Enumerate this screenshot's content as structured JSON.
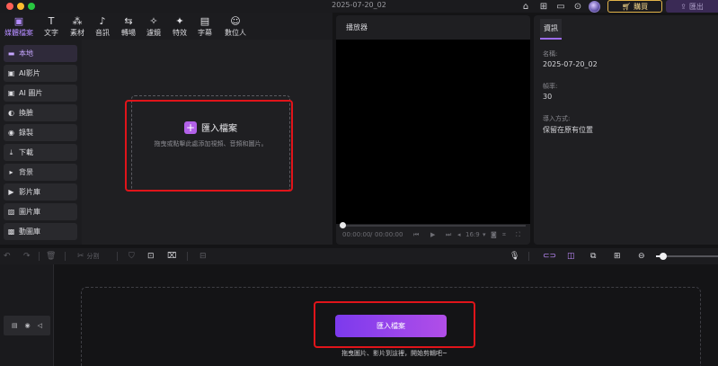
{
  "window": {
    "title": "2025-07-20_02",
    "buy_label": "購買",
    "export_label": "匯出"
  },
  "media_tabs": [
    {
      "label": "媒體檔案",
      "icon": "media-icon",
      "glyph": "▣"
    },
    {
      "label": "文字",
      "icon": "text-icon",
      "glyph": "T"
    },
    {
      "label": "素材",
      "icon": "elements-icon",
      "glyph": "⁂"
    },
    {
      "label": "音訊",
      "icon": "music-icon",
      "glyph": "♪"
    },
    {
      "label": "轉場",
      "icon": "transition-icon",
      "glyph": "⇆"
    },
    {
      "label": "濾鏡",
      "icon": "filter-icon",
      "glyph": "✧"
    },
    {
      "label": "特效",
      "icon": "effects-icon",
      "glyph": "✦"
    },
    {
      "label": "字幕",
      "icon": "subtitle-icon",
      "glyph": "▤"
    },
    {
      "label": "數位人",
      "icon": "avatar-icon",
      "glyph": "☺"
    }
  ],
  "sidebar": {
    "items": [
      {
        "label": "本地",
        "icon": "folder-icon",
        "glyph": "▬"
      },
      {
        "label": "AI影片",
        "icon": "ai-video-icon",
        "glyph": "▣"
      },
      {
        "label": "AI 圖片",
        "icon": "ai-image-icon",
        "glyph": "▣"
      },
      {
        "label": "換臉",
        "icon": "face-swap-icon",
        "glyph": "◐"
      },
      {
        "label": "錄製",
        "icon": "record-icon",
        "glyph": "◉"
      },
      {
        "label": "下載",
        "icon": "download-icon",
        "glyph": "⤓"
      },
      {
        "label": "背景",
        "icon": "background-icon",
        "glyph": "▸"
      },
      {
        "label": "影片庫",
        "icon": "video-library-icon",
        "glyph": "▶"
      },
      {
        "label": "圖片庫",
        "icon": "image-library-icon",
        "glyph": "▨"
      },
      {
        "label": "動圖庫",
        "icon": "gif-library-icon",
        "glyph": "▩"
      }
    ]
  },
  "media_area": {
    "import_title": "匯入檔案",
    "import_hint": "拖曳或點擊此處添加視頻、音頻和圖片。"
  },
  "player": {
    "title": "播放器",
    "time_current": "00:00:00",
    "time_total": "00:00:00",
    "aspect": "16:9"
  },
  "properties": {
    "tab": "資訊",
    "name_label": "名稱:",
    "name_value": "2025-07-20_02",
    "fps_label": "幀率:",
    "fps_value": "30",
    "import_label": "導入方式:",
    "import_value": "保留在原有位置"
  },
  "timeline_toolbar": {
    "split_label": "分割",
    "zoom_level": 0.12
  },
  "timeline": {
    "import_button": "匯入檔案",
    "hint": "拖曳圖片、影片到這裡，開始剪輯吧~"
  },
  "colors": {
    "accent": "#9c6cf0",
    "highlight_box": "#e0141a",
    "buy_gold": "#e2b44a"
  }
}
